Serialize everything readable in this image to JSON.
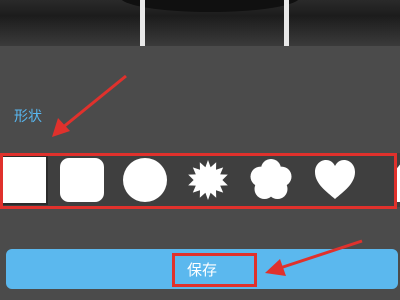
{
  "panel": {
    "shape_label": "形状",
    "save_label": "保存"
  },
  "shapes": [
    "square-icon",
    "rounded-square-icon",
    "circle-icon",
    "starburst-icon",
    "flower-icon",
    "heart-icon",
    "tag-icon"
  ],
  "colors": {
    "accent": "#58b7f0",
    "button": "#5bb8ee",
    "highlight": "#e0312c",
    "panel": "#4b4b4b"
  }
}
